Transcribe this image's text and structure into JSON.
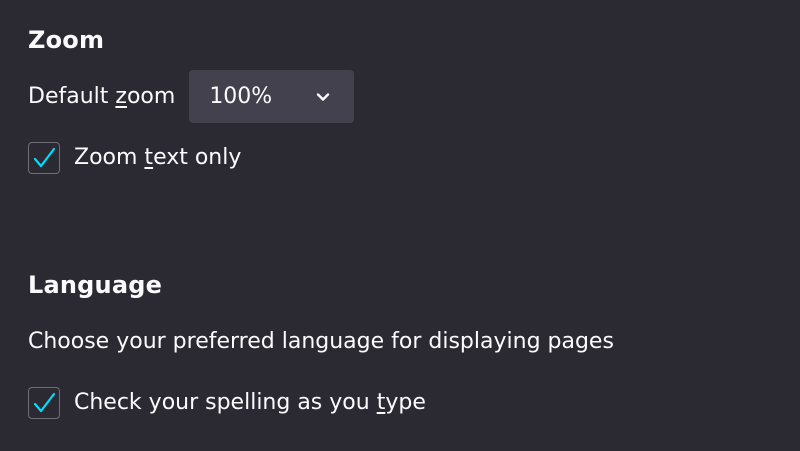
{
  "zoom": {
    "heading": "Zoom",
    "default_zoom_label_pre": "Default ",
    "default_zoom_label_key": "z",
    "default_zoom_label_post": "oom",
    "default_zoom_value": "100%",
    "zoom_text_only": {
      "label_pre": "Zoom ",
      "label_key": "t",
      "label_post": "ext only",
      "checked": true
    }
  },
  "language": {
    "heading": "Language",
    "description": "Choose your preferred language for displaying pages",
    "spell_check": {
      "label_pre": "Check your spelling as you ",
      "label_key": "t",
      "label_post": "ype",
      "checked": true
    }
  },
  "colors": {
    "background": "#2b2a33",
    "text": "#fbfbfe",
    "select_bg": "#42414d",
    "check_accent": "#00ddff"
  },
  "icons": {
    "dropdown": "chevron-down-icon",
    "checkmark": "checkmark-icon"
  }
}
